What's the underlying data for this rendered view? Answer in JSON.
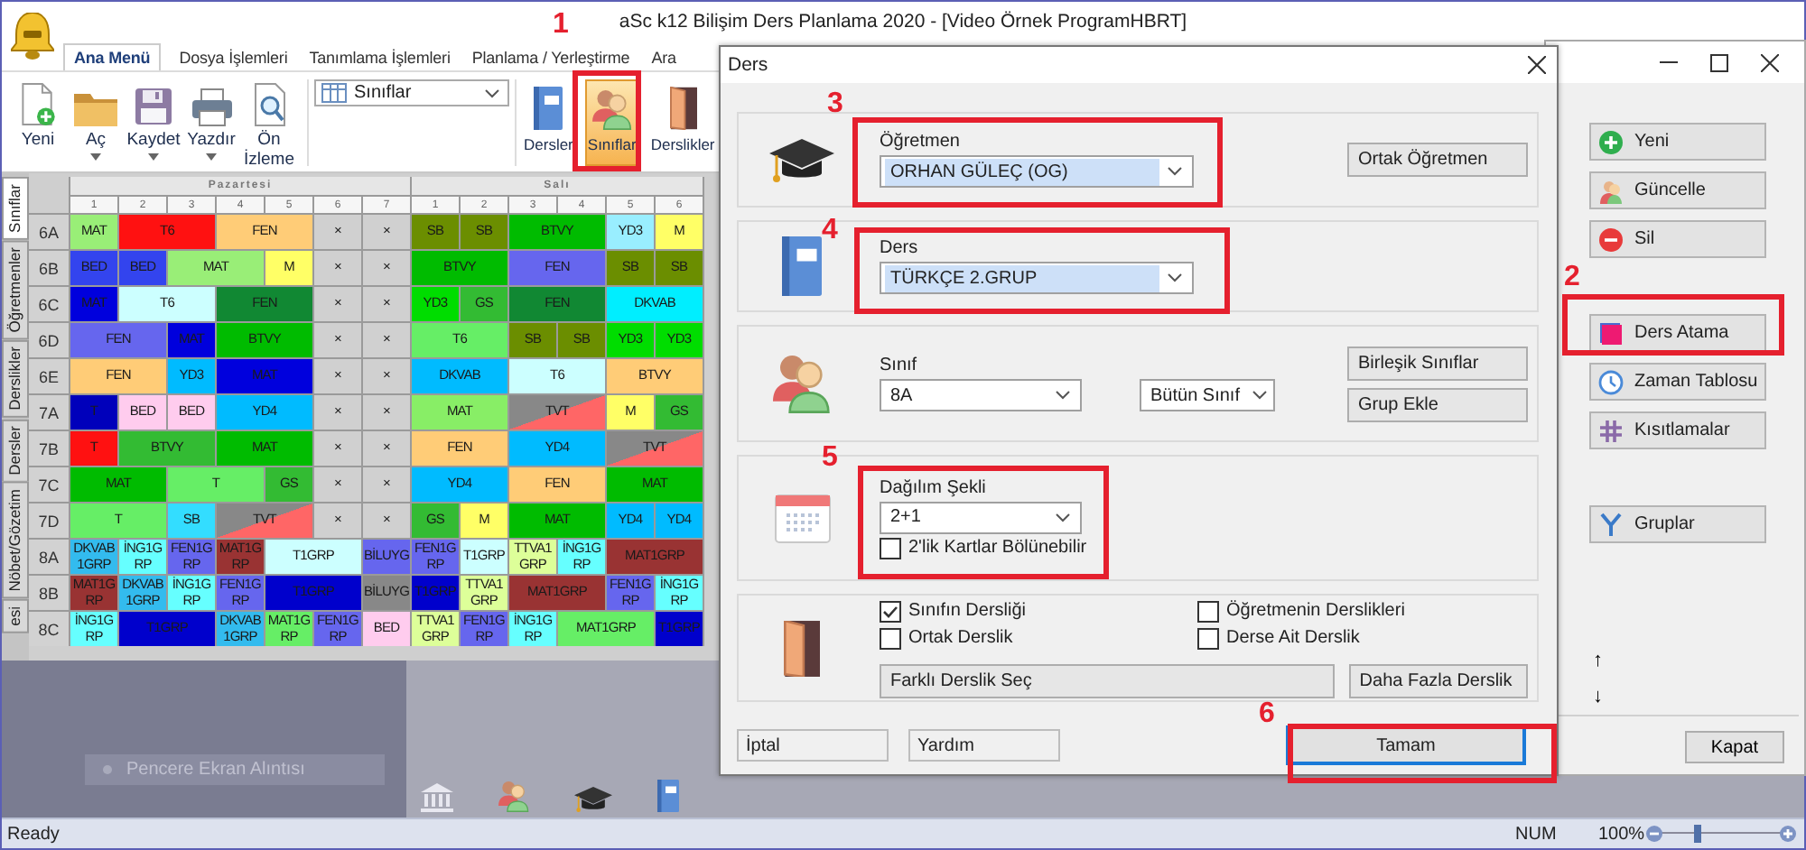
{
  "main_window": {
    "title": "aSc k12 Bilişim Ders Planlama 2020 - [Video Örnek ProgramHBRT]",
    "tabs": [
      {
        "label": "Ana Menü",
        "selected": true
      },
      {
        "label": "Dosya İşlemleri",
        "selected": false
      },
      {
        "label": "Tanımlama İşlemleri",
        "selected": false
      },
      {
        "label": "Planlama / Yerleştirme",
        "selected": false
      },
      {
        "label": "Ara",
        "selected": false
      }
    ],
    "ribbon": {
      "file_buttons": [
        {
          "label": "Yeni",
          "dropdown": false
        },
        {
          "label": "Aç",
          "dropdown": true
        },
        {
          "label": "Kaydet",
          "dropdown": true
        },
        {
          "label": "Yazdır",
          "dropdown": true
        },
        {
          "label": "Ön İzleme",
          "dropdown": false
        }
      ],
      "view_select": {
        "value": "Sınıflar"
      },
      "view_buttons": [
        {
          "label": "Dersler",
          "selected": false
        },
        {
          "label": "Sınıflar",
          "selected": true
        },
        {
          "label": "Derslikler",
          "selected": false
        }
      ]
    },
    "side_tabs": [
      {
        "label": "Sınıflar",
        "selected": true
      },
      {
        "label": "Öğretmenler",
        "selected": false
      },
      {
        "label": "Derslikler",
        "selected": false
      },
      {
        "label": "Dersler",
        "selected": false
      },
      {
        "label": "Nöbet/Gözetim",
        "selected": false
      },
      {
        "label": "esi",
        "selected": false
      }
    ],
    "timetable": {
      "days": [
        {
          "name": "Pazartesi",
          "periods": [
            "1",
            "2",
            "3",
            "4",
            "5",
            "6",
            "7"
          ]
        },
        {
          "name": "Salı",
          "periods": [
            "1",
            "2",
            "3",
            "4",
            "5",
            "6"
          ]
        }
      ],
      "rows": [
        {
          "label": "6A",
          "days": [
            [
              {
                "text": "MAT",
                "double": false,
                "color": "#99ee77"
              },
              {
                "text": "T6",
                "double": true,
                "color": "#ff1111"
              },
              {
                "text": "FEN",
                "double": true,
                "color": "#ffcc77"
              },
              {
                "text": "×",
                "double": false,
                "color": "#d0d0d0"
              },
              {
                "text": "×",
                "double": false,
                "color": "#d0d0d0"
              }
            ],
            [
              {
                "text": "SB",
                "double": false,
                "color": "#6b8e00"
              },
              {
                "text": "SB",
                "double": false,
                "color": "#6b8e00"
              },
              {
                "text": "BTVY",
                "double": true,
                "color": "#00bb00"
              },
              {
                "text": "YD3",
                "double": false,
                "color": "#99eeff"
              },
              {
                "text": "M",
                "double": false,
                "color": "#ffff66"
              }
            ]
          ]
        },
        {
          "label": "6B",
          "days": [
            [
              {
                "text": "BED",
                "double": false,
                "color": "#3344ee"
              },
              {
                "text": "BED",
                "double": false,
                "color": "#3344ee"
              },
              {
                "text": "MAT",
                "double": true,
                "color": "#99ee77"
              },
              {
                "text": "M",
                "double": false,
                "color": "#ffff66"
              },
              {
                "text": "×",
                "double": false,
                "color": "#d0d0d0"
              },
              {
                "text": "×",
                "double": false,
                "color": "#d0d0d0"
              }
            ],
            [
              {
                "text": "BTVY",
                "double": true,
                "color": "#00bb00"
              },
              {
                "text": "FEN",
                "double": true,
                "color": "#6666ee"
              },
              {
                "text": "SB",
                "double": false,
                "color": "#6b8e00"
              },
              {
                "text": "SB",
                "double": false,
                "color": "#6b8e00"
              }
            ]
          ]
        },
        {
          "label": "6C",
          "days": [
            [
              {
                "text": "MAT",
                "double": false,
                "color": "#0000dd"
              },
              {
                "text": "T6",
                "double": true,
                "color": "#ccffff"
              },
              {
                "text": "FEN",
                "double": true,
                "color": "#118833"
              },
              {
                "text": "×",
                "double": false,
                "color": "#d0d0d0"
              },
              {
                "text": "×",
                "double": false,
                "color": "#d0d0d0"
              }
            ],
            [
              {
                "text": "YD3",
                "double": false,
                "color": "#00dd00"
              },
              {
                "text": "GS",
                "double": false,
                "color": "#33bb33"
              },
              {
                "text": "FEN",
                "double": true,
                "color": "#118833"
              },
              {
                "text": "DKVAB",
                "double": true,
                "color": "#00eeff"
              }
            ]
          ]
        },
        {
          "label": "6D",
          "days": [
            [
              {
                "text": "FEN",
                "double": true,
                "color": "#6666ee"
              },
              {
                "text": "MAT",
                "double": false,
                "color": "#0000dd"
              },
              {
                "text": "BTVY",
                "double": true,
                "color": "#00bb00"
              },
              {
                "text": "×",
                "double": false,
                "color": "#d0d0d0"
              },
              {
                "text": "×",
                "double": false,
                "color": "#d0d0d0"
              }
            ],
            [
              {
                "text": "T6",
                "double": true,
                "color": "#66ee66"
              },
              {
                "text": "SB",
                "double": false,
                "color": "#6b8e00"
              },
              {
                "text": "SB",
                "double": false,
                "color": "#6b8e00"
              },
              {
                "text": "YD3",
                "double": false,
                "color": "#00dd00"
              },
              {
                "text": "YD3",
                "double": false,
                "color": "#00dd00"
              }
            ]
          ]
        },
        {
          "label": "6E",
          "days": [
            [
              {
                "text": "FEN",
                "double": true,
                "color": "#ffcc77"
              },
              {
                "text": "YD3",
                "double": false,
                "color": "#00bbff"
              },
              {
                "text": "MAT",
                "double": true,
                "color": "#0000dd"
              },
              {
                "text": "×",
                "double": false,
                "color": "#d0d0d0"
              },
              {
                "text": "×",
                "double": false,
                "color": "#d0d0d0"
              }
            ],
            [
              {
                "text": "DKVAB",
                "double": true,
                "color": "#00bbff"
              },
              {
                "text": "T6",
                "double": true,
                "color": "#ccffff"
              },
              {
                "text": "BTVY",
                "double": true,
                "color": "#ffcc77"
              }
            ]
          ]
        },
        {
          "label": "7A",
          "days": [
            [
              {
                "text": "T",
                "double": false,
                "color": "#0000bb"
              },
              {
                "text": "BED",
                "double": false,
                "color": "#ffccee"
              },
              {
                "text": "BED",
                "double": false,
                "color": "#ffccee"
              },
              {
                "text": "YD4",
                "double": true,
                "color": "#00bbff"
              },
              {
                "text": "×",
                "double": false,
                "color": "#d0d0d0"
              },
              {
                "text": "×",
                "double": false,
                "color": "#d0d0d0"
              }
            ],
            [
              {
                "text": "MAT",
                "double": true,
                "color": "#88ee66"
              },
              {
                "text": "TVT",
                "double": true,
                "color": "#888888",
                "conflict": true
              },
              {
                "text": "M",
                "double": false,
                "color": "#ffff66"
              },
              {
                "text": "GS",
                "double": false,
                "color": "#33bb33"
              }
            ]
          ]
        },
        {
          "label": "7B",
          "days": [
            [
              {
                "text": "T",
                "double": false,
                "color": "#ff1111"
              },
              {
                "text": "BTVY",
                "double": true,
                "color": "#33bb33"
              },
              {
                "text": "MAT",
                "double": true,
                "color": "#00bb00"
              },
              {
                "text": "×",
                "double": false,
                "color": "#d0d0d0"
              },
              {
                "text": "×",
                "double": false,
                "color": "#d0d0d0"
              }
            ],
            [
              {
                "text": "FEN",
                "double": true,
                "color": "#ffcc77"
              },
              {
                "text": "YD4",
                "double": true,
                "color": "#00bbff"
              },
              {
                "text": "TVT",
                "double": true,
                "color": "#888888",
                "conflict": true
              }
            ]
          ]
        },
        {
          "label": "7C",
          "days": [
            [
              {
                "text": "MAT",
                "double": true,
                "color": "#00bb00"
              },
              {
                "text": "T",
                "double": true,
                "color": "#66ee66"
              },
              {
                "text": "GS",
                "double": false,
                "color": "#33bb33"
              },
              {
                "text": "×",
                "double": false,
                "color": "#d0d0d0"
              },
              {
                "text": "×",
                "double": false,
                "color": "#d0d0d0"
              }
            ],
            [
              {
                "text": "YD4",
                "double": true,
                "color": "#00bbff"
              },
              {
                "text": "FEN",
                "double": true,
                "color": "#ffcc77"
              },
              {
                "text": "MAT",
                "double": true,
                "color": "#00bb00"
              }
            ]
          ]
        },
        {
          "label": "7D",
          "days": [
            [
              {
                "text": "T",
                "double": true,
                "color": "#66ee66"
              },
              {
                "text": "SB",
                "double": false,
                "color": "#33ddff"
              },
              {
                "text": "TVT",
                "double": true,
                "color": "#888888",
                "conflict": true
              },
              {
                "text": "×",
                "double": false,
                "color": "#d0d0d0"
              },
              {
                "text": "×",
                "double": false,
                "color": "#d0d0d0"
              }
            ],
            [
              {
                "text": "GS",
                "double": false,
                "color": "#33bb33"
              },
              {
                "text": "M",
                "double": false,
                "color": "#ffff66"
              },
              {
                "text": "MAT",
                "double": true,
                "color": "#00bb00"
              },
              {
                "text": "YD4",
                "double": false,
                "color": "#00bbff"
              },
              {
                "text": "YD4",
                "double": false,
                "color": "#00bbff"
              }
            ]
          ]
        },
        {
          "label": "8A",
          "days": [
            [
              {
                "text": "DKVAB1GRP",
                "double": false,
                "color": "#33bbee"
              },
              {
                "text": "İNG1GRP",
                "double": false,
                "color": "#66ffff"
              },
              {
                "text": "FEN1GRP",
                "double": false,
                "color": "#6666ee"
              },
              {
                "text": "MAT1GRP",
                "double": false,
                "color": "#993333"
              },
              {
                "text": "T1GRP",
                "double": true,
                "color": "#ccffff"
              },
              {
                "text": "BİLUYG",
                "double": false,
                "color": "#6666ee"
              }
            ],
            [
              {
                "text": "FEN1GRP",
                "double": false,
                "color": "#6666ee"
              },
              {
                "text": "T1GRP",
                "double": false,
                "color": "#ccffff"
              },
              {
                "text": "TTVA1GRP",
                "double": false,
                "color": "#ddff99"
              },
              {
                "text": "İNG1GRP",
                "double": false,
                "color": "#66ffff"
              },
              {
                "text": "MAT1GRP",
                "double": true,
                "color": "#993333"
              }
            ]
          ]
        },
        {
          "label": "8B",
          "days": [
            [
              {
                "text": "MAT1GRP",
                "double": false,
                "color": "#993333"
              },
              {
                "text": "DKVAB1GRP",
                "double": false,
                "color": "#33bbee"
              },
              {
                "text": "İNG1GRP",
                "double": false,
                "color": "#66ffff"
              },
              {
                "text": "FEN1GRP",
                "double": false,
                "color": "#6666ee"
              },
              {
                "text": "T1GRP",
                "double": true,
                "color": "#0000cc"
              },
              {
                "text": "BİLUYG",
                "double": false,
                "color": "#888888"
              }
            ],
            [
              {
                "text": "T1GRP",
                "double": false,
                "color": "#0000cc"
              },
              {
                "text": "TTVA1GRP",
                "double": false,
                "color": "#ddff99"
              },
              {
                "text": "MAT1GRP",
                "double": true,
                "color": "#993333"
              },
              {
                "text": "FEN1GRP",
                "double": false,
                "color": "#6666ee"
              },
              {
                "text": "İNG1GRP",
                "double": false,
                "color": "#66ffff"
              }
            ]
          ]
        },
        {
          "label": "8C",
          "days": [
            [
              {
                "text": "İNG1GRP",
                "double": false,
                "color": "#66ffff"
              },
              {
                "text": "T1GRP",
                "double": true,
                "color": "#0000cc"
              },
              {
                "text": "DKVAB1GRP",
                "double": false,
                "color": "#33bbee"
              },
              {
                "text": "MAT1GRP",
                "double": false,
                "color": "#66ee66"
              },
              {
                "text": "FEN1GRP",
                "double": false,
                "color": "#6666ee"
              },
              {
                "text": "BED",
                "double": false,
                "color": "#ffccee"
              }
            ],
            [
              {
                "text": "TTVA1GRP",
                "double": false,
                "color": "#ddff99"
              },
              {
                "text": "FEN1GRP",
                "double": false,
                "color": "#6666ee"
              },
              {
                "text": "İNG1GRP",
                "double": false,
                "color": "#66ffff"
              },
              {
                "text": "MAT1GRP",
                "double": true,
                "color": "#66ee66"
              },
              {
                "text": "T1GRP",
                "double": false,
                "color": "#0000cc"
              }
            ]
          ]
        }
      ]
    },
    "tooltip": {
      "text": "Pencere Ekran Alıntısı"
    },
    "status_bar": {
      "text": "Ready",
      "num": "NUM",
      "zoom": "100%",
      "zoom_slider": {
        "level": 0.3
      }
    }
  },
  "side_window": {
    "button_groups": [
      [
        "Yeni",
        "Güncelle",
        "Sil"
      ],
      [
        "Ders Atama",
        "Zaman Tablosu",
        "Kısıtlamalar"
      ],
      [
        "Gruplar"
      ]
    ],
    "arrows": [
      "↑",
      "↓"
    ],
    "close_button": "Kapat"
  },
  "dialog": {
    "title": "Ders",
    "teacher": {
      "label": "Öğretmen",
      "value": "ORHAN GÜLEÇ (OG)",
      "highlighted": true,
      "button": "Ortak Öğretmen"
    },
    "subject": {
      "label": "Ders",
      "value": "TÜRKÇE 2.GRUP",
      "highlighted": true
    },
    "class": {
      "label": "Sınıf",
      "value": "8A",
      "group_value": "Bütün Sınıf",
      "buttons": [
        "Birleşik Sınıflar",
        "Grup Ekle"
      ]
    },
    "distribution": {
      "label": "Dağılım Şekli",
      "value": "2+1",
      "checkbox": {
        "label": "2'lik Kartlar Bölünebilir",
        "checked": false
      }
    },
    "room": {
      "checkboxes": [
        {
          "label": "Sınıfın Dersliği",
          "checked": true
        },
        {
          "label": "Ortak Derslik",
          "checked": false
        },
        {
          "label": "Öğretmenin Derslikleri",
          "checked": false
        },
        {
          "label": "Derse Ait Derslik",
          "checked": false
        }
      ],
      "buttons": [
        "Farklı Derslik Seç",
        "Daha Fazla Derslik"
      ]
    },
    "footer_buttons": [
      {
        "label": "İptal",
        "default": false
      },
      {
        "label": "Yardım",
        "default": false
      },
      {
        "label": "Tamam",
        "default": true
      }
    ]
  },
  "annotations": [
    {
      "number": "1"
    },
    {
      "number": "2"
    },
    {
      "number": "3"
    },
    {
      "number": "4"
    },
    {
      "number": "5"
    },
    {
      "number": "6"
    }
  ]
}
